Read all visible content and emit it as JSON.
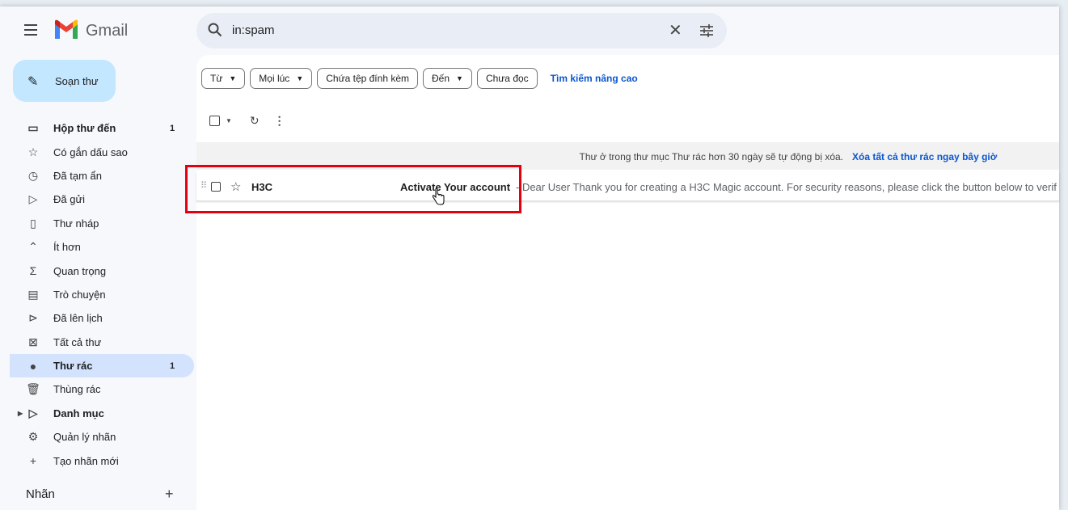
{
  "app": {
    "logo_text": "Gmail"
  },
  "search": {
    "query": "in:spam"
  },
  "compose": {
    "label": "Soạn thư"
  },
  "sidebar": {
    "items": [
      {
        "label": "Hộp thư đến",
        "count": "1",
        "icon": "inbox-icon",
        "bold": true
      },
      {
        "label": "Có gắn dấu sao",
        "count": "",
        "icon": "star-icon"
      },
      {
        "label": "Đã tạm ẩn",
        "count": "",
        "icon": "clock-icon"
      },
      {
        "label": "Đã gửi",
        "count": "",
        "icon": "send-icon"
      },
      {
        "label": "Thư nháp",
        "count": "",
        "icon": "draft-icon"
      },
      {
        "label": "Ít hơn",
        "count": "",
        "icon": "chevron-up-icon"
      },
      {
        "label": "Quan trọng",
        "count": "",
        "icon": "important-icon"
      },
      {
        "label": "Trò chuyện",
        "count": "",
        "icon": "chat-icon"
      },
      {
        "label": "Đã lên lịch",
        "count": "",
        "icon": "scheduled-icon"
      },
      {
        "label": "Tất cả thư",
        "count": "",
        "icon": "all-mail-icon"
      },
      {
        "label": "Thư rác",
        "count": "1",
        "icon": "spam-icon",
        "bold": true,
        "active": true
      },
      {
        "label": "Thùng rác",
        "count": "",
        "icon": "trash-icon"
      },
      {
        "label": "Danh mục",
        "count": "",
        "icon": "label-icon",
        "bold": true
      },
      {
        "label": "Quản lý nhãn",
        "count": "",
        "icon": "settings-icon"
      },
      {
        "label": "Tạo nhãn mới",
        "count": "",
        "icon": "plus-icon"
      }
    ],
    "labels_heading": "Nhãn"
  },
  "filters": {
    "chips": [
      "Từ",
      "Mọi lúc",
      "Chứa tệp đính kèm",
      "Đến",
      "Chưa đọc"
    ],
    "advanced": "Tìm kiếm nâng cao"
  },
  "banner": {
    "message": "Thư ở trong thư mục Thư rác hơn 30 ngày sẽ tự động bị xóa.",
    "action": "Xóa tất cả thư rác ngay bây giờ"
  },
  "emails": [
    {
      "from": "H3C",
      "subject": "Activate Your account",
      "snippet": "- Dear User Thank you for creating a H3C Magic account. For security reasons, please click the button below to verif"
    }
  ],
  "colors": {
    "accent": "#0b57d0",
    "compose_bg": "#c2e7ff",
    "active_bg": "#d3e3fd",
    "highlight": "#e4000f"
  }
}
